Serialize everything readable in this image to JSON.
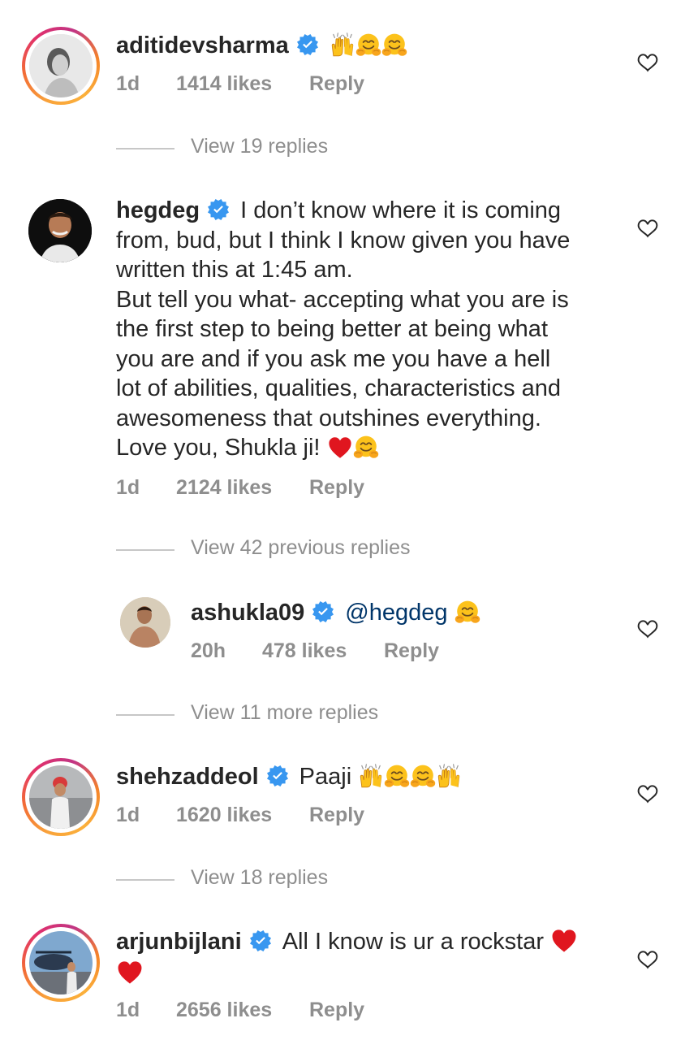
{
  "comments": [
    {
      "username": "aditidevsharma",
      "text": "",
      "emojis": "🙌🤗🤗",
      "time": "1d",
      "likes": "1414 likes",
      "reply": "Reply",
      "view_replies": "View 19 replies"
    },
    {
      "username": "hegdeg",
      "text_lines": [
        "I don’t know where it is coming",
        "from, bud, but I think I know given you have",
        "written this at 1:45 am.",
        "But tell you what- accepting what you are is",
        "the first step to being better at being what",
        "you are and if you ask me you have a hell",
        "lot of abilities, qualities, characteristics and",
        "awesomeness that outshines everything.",
        "Love you, Shukla ji!"
      ],
      "emojis": "❤️🤗",
      "time": "1d",
      "likes": "2124 likes",
      "reply": "Reply",
      "view_replies": "View 42 previous replies"
    },
    {
      "username": "ashukla09",
      "mention": "@hegdeg",
      "emojis": "🤗",
      "time": "20h",
      "likes": "478 likes",
      "reply": "Reply",
      "view_replies": "View 11 more replies"
    },
    {
      "username": "shehzaddeol",
      "text": "Paaji",
      "emojis": "🙌🤗🤗🙌",
      "time": "1d",
      "likes": "1620 likes",
      "reply": "Reply",
      "view_replies": "View 18 replies"
    },
    {
      "username": "arjunbijlani",
      "text": "All I know is ur a rockstar",
      "emojis": "❤️❤️",
      "time": "1d",
      "likes": "2656 likes",
      "reply": "Reply"
    }
  ],
  "colors": {
    "verified": "#3897f0",
    "meta_text": "#8e8e8e",
    "mention": "#003569",
    "heart_red": "#e0161f"
  },
  "icons": {
    "verified": "verified-badge-icon",
    "like": "heart-outline-icon"
  }
}
